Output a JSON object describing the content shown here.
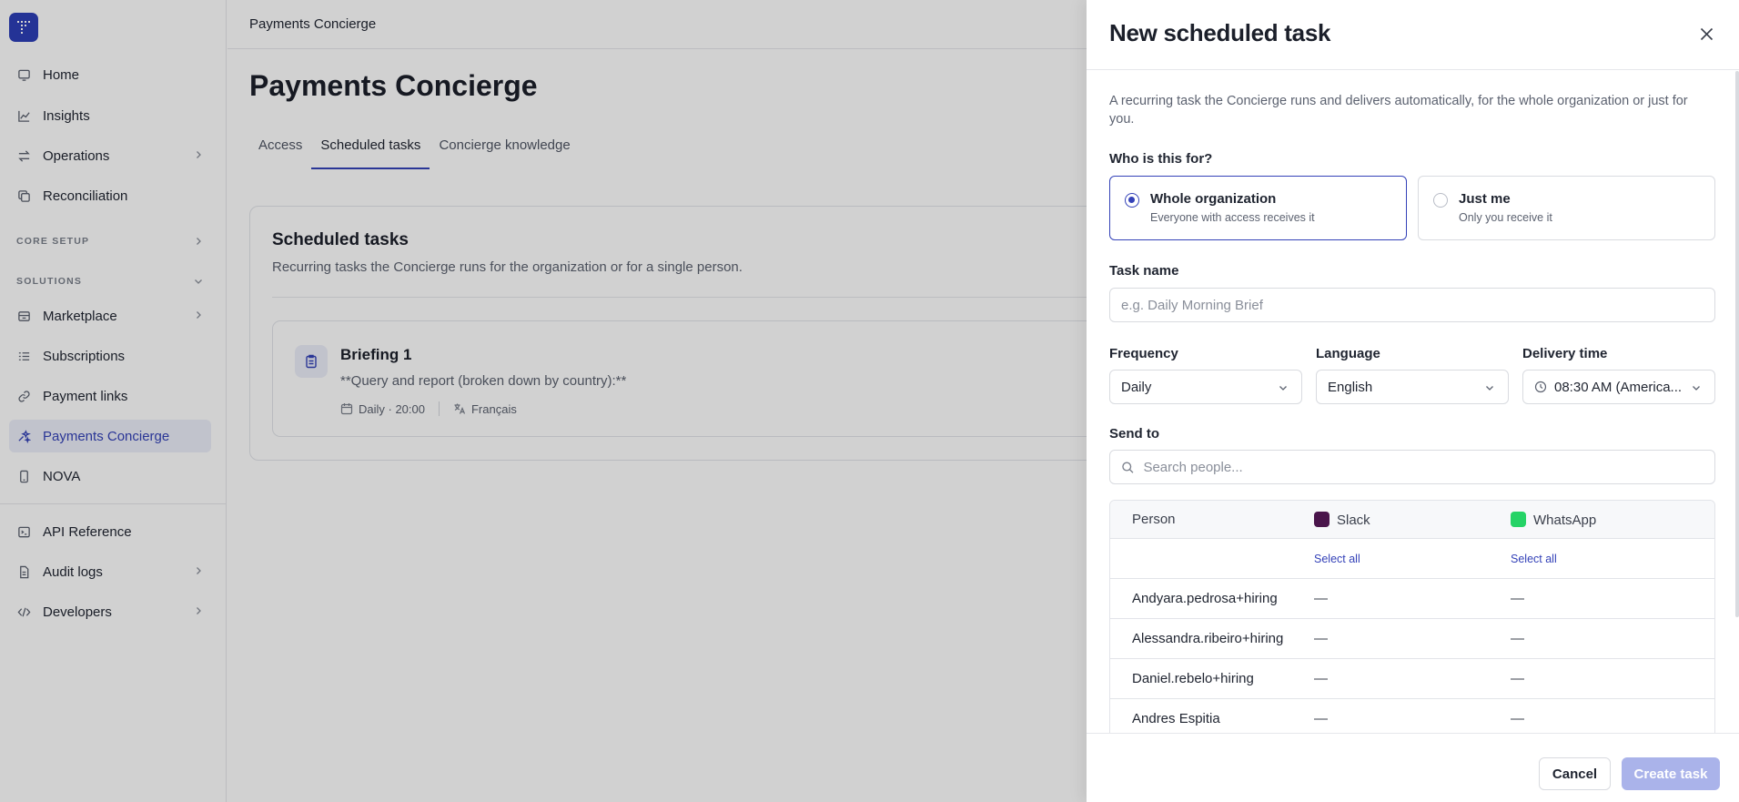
{
  "sidebar": {
    "items_top": [
      {
        "label": "Home",
        "icon": "monitor-icon"
      },
      {
        "label": "Insights",
        "icon": "chart-line-icon"
      },
      {
        "label": "Operations",
        "icon": "arrows-swap-icon"
      },
      {
        "label": "Reconciliation",
        "icon": "copy-icon"
      }
    ],
    "core_setup_label": "CORE SETUP",
    "solutions_label": "SOLUTIONS",
    "solutions_items": [
      {
        "label": "Marketplace",
        "icon": "store-icon"
      },
      {
        "label": "Subscriptions",
        "icon": "list-icon"
      },
      {
        "label": "Payment links",
        "icon": "link-icon"
      },
      {
        "label": "Payments Concierge",
        "icon": "sparkle-icon",
        "active": true
      },
      {
        "label": "NOVA",
        "icon": "phone-icon"
      }
    ],
    "items_bottom": [
      {
        "label": "API Reference",
        "icon": "terminal-icon"
      },
      {
        "label": "Audit logs",
        "icon": "document-icon"
      },
      {
        "label": "Developers",
        "icon": "code-icon"
      }
    ]
  },
  "topbar": {
    "breadcrumb": "Payments Concierge"
  },
  "page": {
    "title": "Payments Concierge",
    "tabs": [
      "Access",
      "Scheduled tasks",
      "Concierge knowledge"
    ],
    "active_tab": "Scheduled tasks"
  },
  "scheduled": {
    "title": "Scheduled tasks",
    "subtitle": "Recurring tasks the Concierge runs for the organization or for a single person.",
    "task": {
      "name": "Briefing 1",
      "description": "**Query and report (broken down by country):**",
      "schedule": "Daily · 20:00",
      "language": "Français"
    }
  },
  "drawer": {
    "title": "New scheduled task",
    "description": "A recurring task the Concierge runs and delivers automatically, for the whole organization or just for you.",
    "who_label": "Who is this for?",
    "options": [
      {
        "title": "Whole organization",
        "subtitle": "Everyone with access receives it",
        "selected": true
      },
      {
        "title": "Just me",
        "subtitle": "Only you receive it",
        "selected": false
      }
    ],
    "task_name_label": "Task name",
    "task_name_placeholder": "e.g. Daily Morning Brief",
    "frequency_label": "Frequency",
    "frequency_value": "Daily",
    "language_label": "Language",
    "language_value": "English",
    "delivery_label": "Delivery time",
    "delivery_value": "08:30 AM (America...",
    "send_to_label": "Send to",
    "search_placeholder": "Search people...",
    "table": {
      "col_person": "Person",
      "col_slack": "Slack",
      "col_whatsapp": "WhatsApp",
      "select_all": "Select all",
      "rows": [
        {
          "person": "Andyara.pedrosa+hiring",
          "slack": "—",
          "whatsapp": "—"
        },
        {
          "person": "Alessandra.ribeiro+hiring",
          "slack": "—",
          "whatsapp": "—"
        },
        {
          "person": "Daniel.rebelo+hiring",
          "slack": "—",
          "whatsapp": "—"
        },
        {
          "person": "Andres Espitia",
          "slack": "—",
          "whatsapp": "—"
        }
      ]
    },
    "cancel_label": "Cancel",
    "create_label": "Create task"
  },
  "colors": {
    "accent": "#3442b8",
    "slack": "#4a154b",
    "whatsapp": "#25d366",
    "create_disabled": "#aab3ea"
  }
}
